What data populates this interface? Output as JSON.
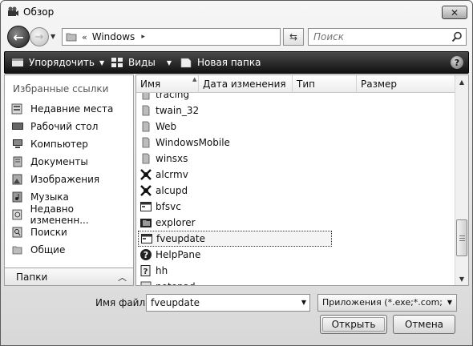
{
  "window": {
    "title": "Обзор"
  },
  "address": {
    "separator": "«",
    "path": "Windows",
    "arrow": "▸"
  },
  "search": {
    "placeholder": "Поиск"
  },
  "toolbar": {
    "organize_label": "Упорядочить",
    "views_label": "Виды",
    "new_folder_label": "Новая папка",
    "help_label": "?"
  },
  "navpane": {
    "header": "Избранные ссылки",
    "items": [
      {
        "label": "Недавние места",
        "icon": "recent-places-icon"
      },
      {
        "label": "Рабочий стол",
        "icon": "desktop-icon"
      },
      {
        "label": "Компьютер",
        "icon": "computer-icon"
      },
      {
        "label": "Документы",
        "icon": "documents-icon"
      },
      {
        "label": "Изображения",
        "icon": "pictures-icon"
      },
      {
        "label": "Музыка",
        "icon": "music-icon"
      },
      {
        "label": "Недавно измененн...",
        "icon": "recently-changed-icon"
      },
      {
        "label": "Поиски",
        "icon": "searches-icon"
      },
      {
        "label": "Общие",
        "icon": "public-icon"
      }
    ],
    "folders_label": "Папки"
  },
  "filelist": {
    "columns": [
      "Имя",
      "Дата изменения",
      "Тип",
      "Размер"
    ],
    "items": [
      {
        "name": "tracing",
        "icon": "folder-icon"
      },
      {
        "name": "twain_32",
        "icon": "folder-icon"
      },
      {
        "name": "Web",
        "icon": "folder-icon"
      },
      {
        "name": "WindowsMobile",
        "icon": "folder-icon"
      },
      {
        "name": "winsxs",
        "icon": "folder-icon"
      },
      {
        "name": "alcrmv",
        "icon": "gear-app-icon"
      },
      {
        "name": "alcupd",
        "icon": "gear-app-icon"
      },
      {
        "name": "bfsvc",
        "icon": "window-app-icon"
      },
      {
        "name": "explorer",
        "icon": "explorer-app-icon"
      },
      {
        "name": "fveupdate",
        "icon": "window-app-icon",
        "selected": true
      },
      {
        "name": "HelpPane",
        "icon": "help-app-icon"
      },
      {
        "name": "hh",
        "icon": "help-doc-app-icon"
      },
      {
        "name": "notepad",
        "icon": "notepad-app-icon"
      }
    ]
  },
  "bottom": {
    "filename_label": "Имя файла:",
    "filename_value": "fveupdate",
    "filter_value": "Приложения (*.exe;*.com;*.icd",
    "open_label": "Открыть",
    "cancel_label": "Отмена"
  }
}
